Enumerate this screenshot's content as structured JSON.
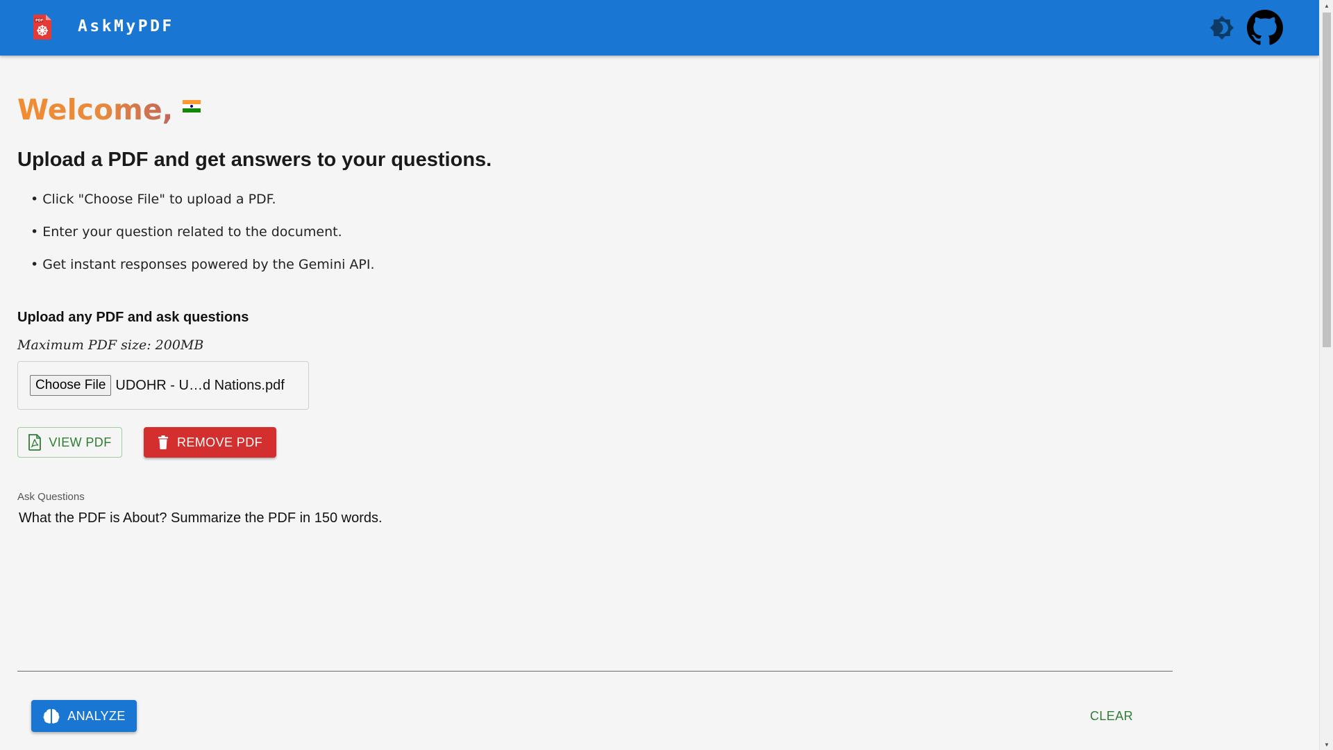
{
  "header": {
    "title": "AskMyPDF",
    "logo_icon": "pdf-logo-icon",
    "theme_icon": "brightness-icon",
    "github_icon": "github-icon"
  },
  "colors": {
    "appbar": "#1976d2",
    "welcome_gradient_start": "#f28c32",
    "welcome_gradient_end": "#c0665a",
    "remove_button": "#d32f2f",
    "view_button_text": "#2e7d32",
    "analyze_button": "#1976d2"
  },
  "welcome": {
    "text": "Welcome,",
    "flag_icon": "india-flag-icon"
  },
  "intro": {
    "headline": "Upload a PDF and get answers to your questions.",
    "bullets": [
      "Click \"Choose File\" to upload a PDF.",
      "Enter your question related to the document.",
      "Get instant responses powered by the Gemini API."
    ]
  },
  "upload": {
    "title": "Upload any PDF and ask questions",
    "hint": "Maximum PDF size: 200MB",
    "choose_label": "Choose File",
    "file_name": "UDOHR - U…d Nations.pdf",
    "view_label": "VIEW PDF",
    "remove_label": "REMOVE PDF"
  },
  "question": {
    "label": "Ask Questions",
    "value": "What the PDF is About? Summarize the PDF in 150 words."
  },
  "actions": {
    "analyze_label": "ANALYZE",
    "clear_label": "CLEAR"
  }
}
